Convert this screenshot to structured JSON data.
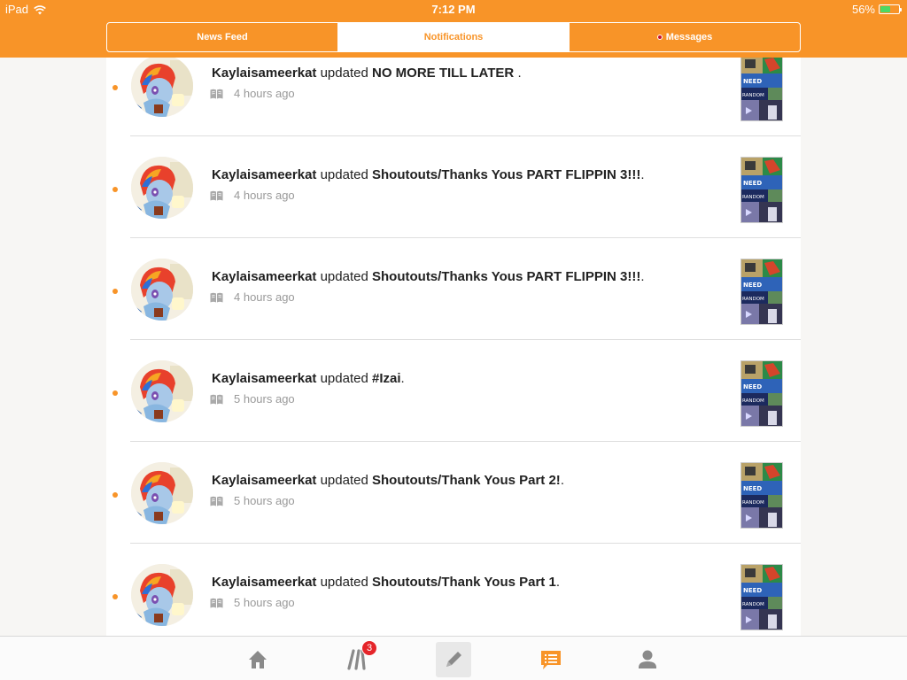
{
  "status_bar": {
    "carrier": "iPad",
    "time": "7:12 PM",
    "battery": "56%",
    "battery_level": 0.56
  },
  "segments": [
    {
      "label": "News Feed",
      "active": false
    },
    {
      "label": "Notifications",
      "active": true
    },
    {
      "label": "Messages",
      "active": false,
      "has_unread_dot": true
    }
  ],
  "notifications": [
    {
      "user": "Kaylaisameerkat",
      "verb": "updated",
      "title": "NO MORE TILL LATER",
      "suffix": " .",
      "time": "4 hours ago",
      "unread": true
    },
    {
      "user": "Kaylaisameerkat",
      "verb": "updated",
      "title": "Shoutouts/Thanks Yous PART FLIPPIN 3!!!",
      "suffix": ".",
      "time": "4 hours ago",
      "unread": true
    },
    {
      "user": "Kaylaisameerkat",
      "verb": "updated",
      "title": "Shoutouts/Thanks Yous PART FLIPPIN 3!!!",
      "suffix": ".",
      "time": "4 hours ago",
      "unread": true
    },
    {
      "user": "Kaylaisameerkat",
      "verb": "updated",
      "title": "#Izai",
      "suffix": ".",
      "time": "5 hours ago",
      "unread": true
    },
    {
      "user": "Kaylaisameerkat",
      "verb": "updated",
      "title": "Shoutouts/Thank Yous Part 2!",
      "suffix": ".",
      "time": "5 hours ago",
      "unread": true
    },
    {
      "user": "Kaylaisameerkat",
      "verb": "updated",
      "title": "Shoutouts/Thank Yous Part 1",
      "suffix": ".",
      "time": "5 hours ago",
      "unread": true
    }
  ],
  "tab_bar": [
    {
      "icon": "home-icon",
      "active": false
    },
    {
      "icon": "library-icon",
      "active": false,
      "badge": "3"
    },
    {
      "icon": "write-icon",
      "active": false
    },
    {
      "icon": "notifications-icon",
      "active": true
    },
    {
      "icon": "profile-icon",
      "active": false
    }
  ],
  "colors": {
    "brand": "#f89428",
    "unread_dot": "#f89428",
    "badge": "#e5252a",
    "battery": "#4cd964"
  }
}
